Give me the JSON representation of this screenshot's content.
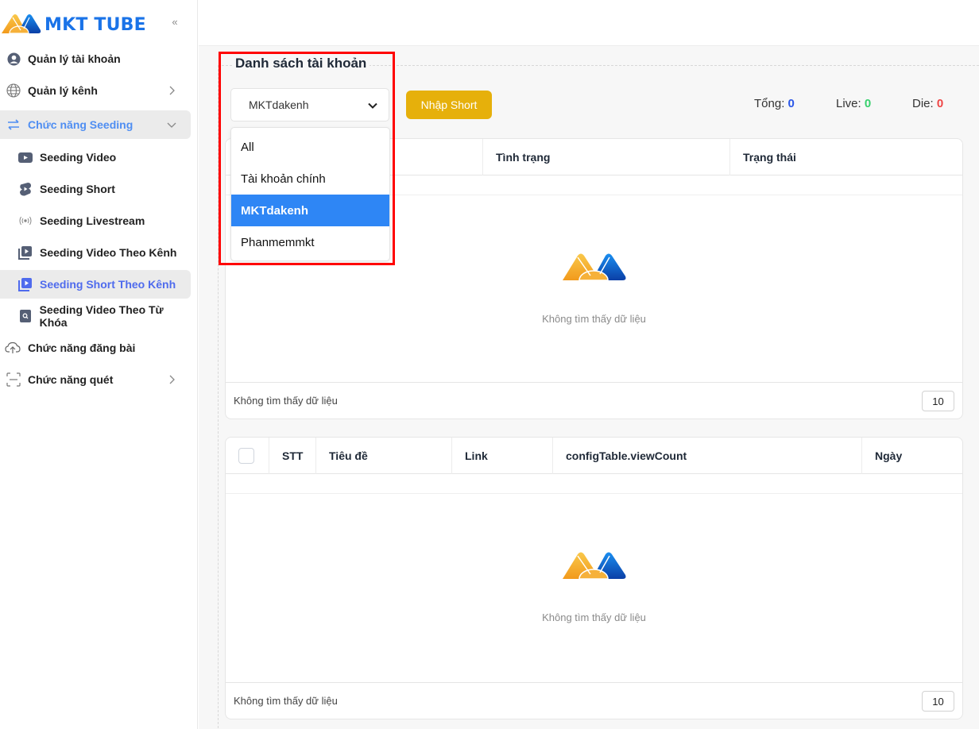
{
  "brand": {
    "name": "MKT TUBE",
    "logo_icon": "mkt-logo-icon"
  },
  "sidebar": {
    "collapse_icon": "chevrons-left-icon",
    "items": [
      {
        "label": "Quản lý tài khoản",
        "icon": "user-circle-icon"
      },
      {
        "label": "Quản lý kênh",
        "icon": "globe-icon",
        "has_chevron": true
      },
      {
        "label": "Chức năng Seeding",
        "icon": "arrows-exchange-icon",
        "expanded": true,
        "children": [
          {
            "label": "Seeding Video",
            "icon": "youtube-icon"
          },
          {
            "label": "Seeding Short",
            "icon": "shorts-icon"
          },
          {
            "label": "Seeding Livestream",
            "icon": "broadcast-icon"
          },
          {
            "label": "Seeding Video Theo Kênh",
            "icon": "video-library-icon"
          },
          {
            "label": "Seeding Short Theo Kênh",
            "icon": "video-library-icon",
            "active": true
          },
          {
            "label": "Seeding Video Theo Từ Khóa",
            "icon": "search-file-icon"
          }
        ]
      },
      {
        "label": "Chức năng đăng bài",
        "icon": "cloud-upload-icon"
      },
      {
        "label": "Chức năng quét",
        "icon": "scan-icon",
        "has_chevron": true
      }
    ]
  },
  "main": {
    "section_title": "Danh sách tài khoản",
    "account_select": {
      "value": "MKTdakenh",
      "options": [
        "All",
        "Tài khoản chính",
        "MKTdakenh",
        "Phanmemmkt"
      ],
      "selected_index": 2
    },
    "import_button": "Nhập Short",
    "stats": {
      "total_label": "Tổng:",
      "total_value": "0",
      "total_color": "#2b57e8",
      "live_label": "Live:",
      "live_value": "0",
      "live_color": "#37d06d",
      "die_label": "Die:",
      "die_value": "0",
      "die_color": "#ef4444"
    },
    "accounts_table": {
      "columns": [
        "",
        "Tình trạng",
        "Trạng thái"
      ],
      "empty_text": "Không tìm thấy dữ liệu",
      "footer_text": "Không tìm thấy dữ liệu",
      "page_size": "10"
    },
    "shorts_table": {
      "columns": [
        "STT",
        "Tiêu đề",
        "Link",
        "configTable.viewCount",
        "Ngày"
      ],
      "empty_text": "Không tìm thấy dữ liệu",
      "footer_text": "Không tìm thấy dữ liệu",
      "page_size": "10"
    }
  }
}
